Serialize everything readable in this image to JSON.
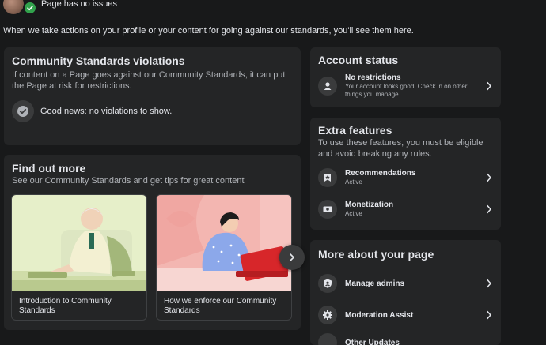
{
  "header": {
    "status_text": "Page has no issues",
    "intro": "When we take actions on your profile or your content for going against our standards, you'll see them here."
  },
  "violations": {
    "title": "Community Standards violations",
    "description": "If content on a Page goes against our Community Standards, it can put the Page at risk for restrictions.",
    "good_news": "Good news: no violations to show."
  },
  "find_out_more": {
    "title": "Find out more",
    "subtitle": "See our Community Standards and get tips for great content",
    "tiles": [
      {
        "caption": "Introduction to Community Standards"
      },
      {
        "caption": "How we enforce our Community Standards"
      }
    ]
  },
  "account_status": {
    "title": "Account status",
    "item": {
      "label": "No restrictions",
      "detail": "Your account looks good! Check in on other things you manage."
    }
  },
  "extra_features": {
    "title": "Extra features",
    "description": "To use these features, you must be eligible and avoid breaking any rules.",
    "items": [
      {
        "label": "Recommendations",
        "status": "Active"
      },
      {
        "label": "Monetization",
        "status": "Active"
      }
    ]
  },
  "more_about": {
    "title": "More about your page",
    "items": [
      {
        "label": "Manage admins"
      },
      {
        "label": "Moderation Assist"
      },
      {
        "label": "Other Updates"
      }
    ]
  },
  "colors": {
    "background": "#18191a",
    "card": "#242526",
    "success_green": "#31a24c",
    "primary_text": "#e4e6eb",
    "secondary_text": "#b0b3b8"
  },
  "icons": [
    "check-icon",
    "checkmark-circle-icon",
    "person-icon",
    "recommendation-icon",
    "monetization-icon",
    "shield-icon",
    "gear-icon",
    "chevron-right-icon"
  ]
}
